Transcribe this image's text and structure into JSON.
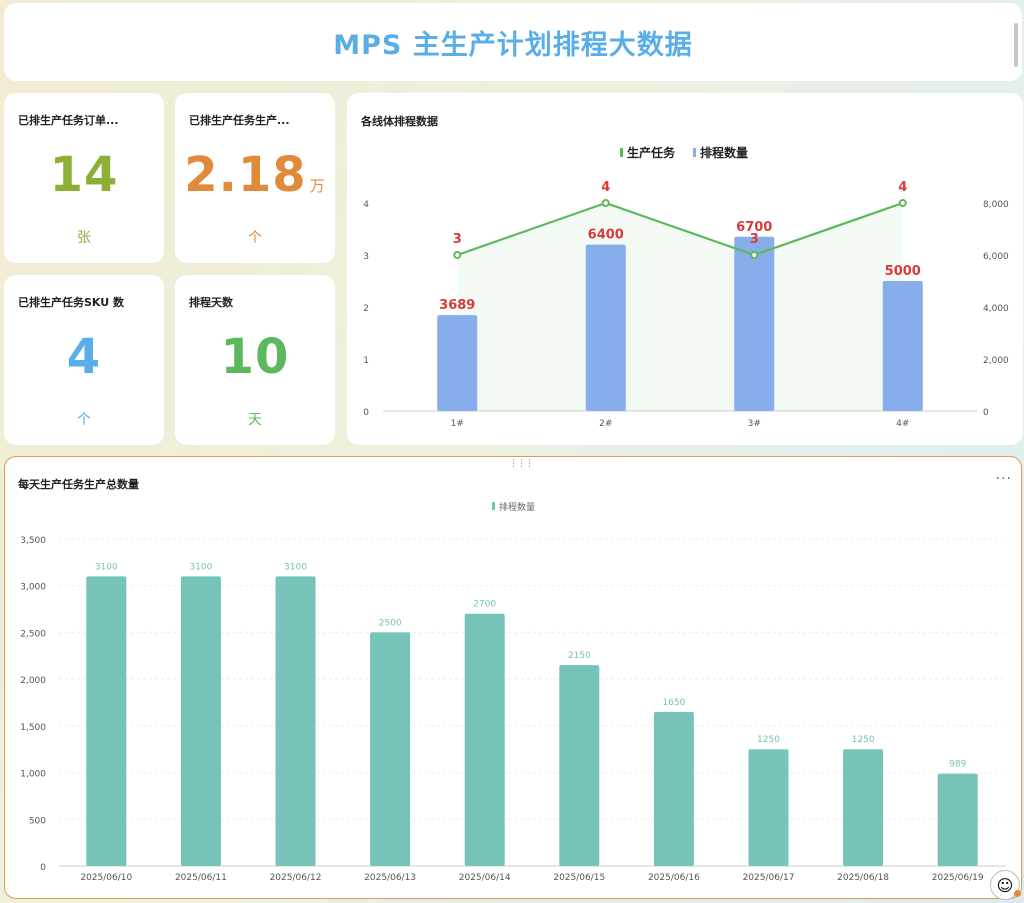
{
  "header": {
    "title": "MPS 主生产计划排程大数据"
  },
  "kpis": [
    {
      "label": "已排生产任务订单...",
      "value": "14",
      "suffix": "",
      "unit": "张",
      "color": "#8cb035"
    },
    {
      "label": "已排生产任务生产...",
      "value": "2.18",
      "suffix": "万",
      "unit": "个",
      "color": "#e08a3c"
    },
    {
      "label": "已排生产任务SKU 数",
      "value": "4",
      "suffix": "",
      "unit": "个",
      "color": "#5aaee8"
    },
    {
      "label": "排程天数",
      "value": "10",
      "suffix": "",
      "unit": "天",
      "color": "#5cb85c"
    }
  ],
  "line_chart_title": "各线体排程数据",
  "daily_chart_title": "每天生产任务生产总数量",
  "colors": {
    "line": "#5cb85c",
    "bar_blue": "#87aeea",
    "bar_teal": "#76c3b9",
    "label_red": "#d93a3a",
    "border_orange": "#e49a4b"
  },
  "chart_data": [
    {
      "type": "bar",
      "title": "各线体排程数据",
      "categories": [
        "1#",
        "2#",
        "3#",
        "4#"
      ],
      "series": [
        {
          "name": "生产任务",
          "type": "line",
          "axis": "left",
          "values": [
            3,
            4,
            3,
            4
          ]
        },
        {
          "name": "排程数量",
          "type": "bar",
          "axis": "right",
          "values": [
            3689,
            6400,
            6700,
            5000
          ]
        }
      ],
      "y_left": {
        "ticks": [
          "0",
          "1",
          "2",
          "3",
          "4"
        ],
        "range": [
          0,
          4
        ]
      },
      "y_right": {
        "ticks": [
          "0",
          "2,000",
          "4,000",
          "6,000",
          "8,000"
        ],
        "range": [
          0,
          8000
        ]
      },
      "legend": "top-center"
    },
    {
      "type": "bar",
      "title": "每天生产任务生产总数量",
      "categories": [
        "2025/06/10",
        "2025/06/11",
        "2025/06/12",
        "2025/06/13",
        "2025/06/14",
        "2025/06/15",
        "2025/06/16",
        "2025/06/17",
        "2025/06/18",
        "2025/06/19"
      ],
      "series": [
        {
          "name": "排程数量",
          "values": [
            3100,
            3100,
            3100,
            2500,
            2700,
            2150,
            1650,
            1250,
            1250,
            989
          ]
        }
      ],
      "y": {
        "ticks": [
          "0",
          "500",
          "1,000",
          "1,500",
          "2,000",
          "2,500",
          "3,000",
          "3,500"
        ],
        "range": [
          0,
          3500
        ]
      },
      "legend": "top-center"
    }
  ]
}
